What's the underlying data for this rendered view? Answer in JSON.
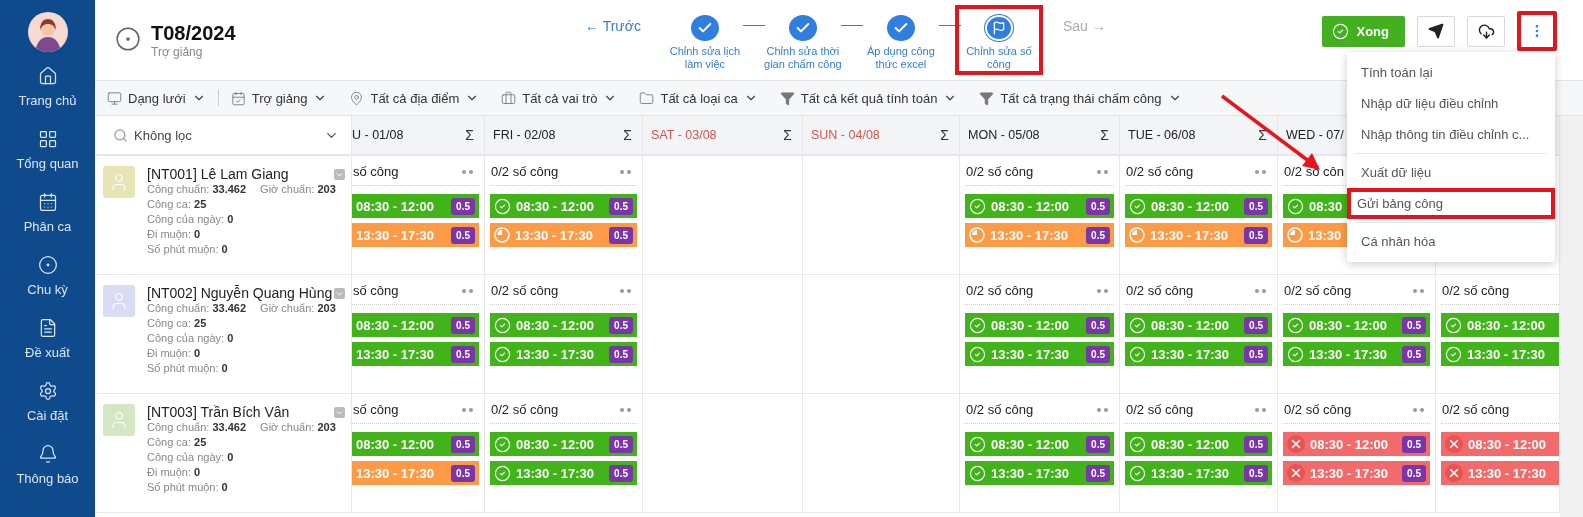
{
  "sidebar": {
    "items": [
      {
        "label": "Trang chủ"
      },
      {
        "label": "Tổng quan"
      },
      {
        "label": "Phân ca"
      },
      {
        "label": "Chu kỳ"
      },
      {
        "label": "Đề xuất"
      },
      {
        "label": "Cài đặt"
      },
      {
        "label": "Thông báo"
      }
    ]
  },
  "header": {
    "title": "T08/2024",
    "subtitle": "Trợ giảng",
    "prev": "← Trước",
    "next": "Sau →",
    "steps": [
      {
        "label": "Chỉnh sửa lịch làm việc",
        "done": true,
        "highlighted": false
      },
      {
        "label": "Chỉnh sửa thời gian chấm công",
        "done": true,
        "highlighted": false
      },
      {
        "label": "Áp dụng công thức excel",
        "done": true,
        "highlighted": false
      },
      {
        "label": "Chỉnh sửa số công",
        "done": false,
        "highlighted": true
      }
    ],
    "done_button": "Xong",
    "more_highlighted": true
  },
  "filters": [
    {
      "label": "Dạng lưới"
    },
    {
      "label": "Trợ giảng"
    },
    {
      "label": "Tất cả địa điểm"
    },
    {
      "label": "Tất cả vai trò"
    },
    {
      "label": "Tất cả loại ca"
    },
    {
      "label": "Tất cả kết quả tính toán"
    },
    {
      "label": "Tất cả trạng thái chấm công"
    }
  ],
  "table": {
    "employee_filter": "Không lọc",
    "columns": [
      {
        "kind": "cut-left",
        "label": "U - 01/08",
        "sum": "Σ",
        "weekend": false
      },
      {
        "kind": "full",
        "label": "FRI - 02/08",
        "sum": "Σ",
        "weekend": false
      },
      {
        "kind": "full",
        "label": "SAT - 03/08",
        "sum": "Σ",
        "weekend": true
      },
      {
        "kind": "full",
        "label": "SUN - 04/08",
        "sum": "Σ",
        "weekend": true
      },
      {
        "kind": "full",
        "label": "MON - 05/08",
        "sum": "Σ",
        "weekend": false
      },
      {
        "kind": "full",
        "label": "TUE - 06/08",
        "sum": "Σ",
        "weekend": false
      },
      {
        "kind": "full",
        "label": "WED - 07/",
        "weekend": false
      },
      {
        "kind": "cut-right"
      }
    ],
    "rows": [
      {
        "name": "[NT001] Lê Lam Giang",
        "color": "#e6e5b3",
        "stats": [
          [
            "Công chuẩn: **33.462**",
            "Giờ chuẩn: **203**"
          ],
          [
            "Công ca: **25**"
          ],
          [
            "Công của ngày: **0**"
          ],
          [
            "Đi muộn: **0**"
          ],
          [
            "Số phút muộn: **0**"
          ]
        ],
        "cells": [
          {
            "title": "số công",
            "menu": true,
            "shifts": [
              {
                "time": "08:30 - 12:00",
                "kind": "checked",
                "value": "0.5"
              },
              {
                "time": "13:30 - 17:30",
                "kind": "waiting",
                "value": "0.5"
              }
            ]
          },
          {
            "title": "0/2 số công",
            "menu": true,
            "shifts": [
              {
                "time": "08:30 - 12:00",
                "kind": "checked",
                "value": "0.5"
              },
              {
                "time": "13:30 - 17:30",
                "kind": "waiting",
                "value": "0.5"
              }
            ]
          },
          null,
          null,
          {
            "title": "0/2 số công",
            "menu": true,
            "shifts": [
              {
                "time": "08:30 - 12:00",
                "kind": "checked",
                "value": "0.5"
              },
              {
                "time": "13:30 - 17:30",
                "kind": "waiting",
                "value": "0.5"
              }
            ]
          },
          {
            "title": "0/2 số công",
            "menu": true,
            "shifts": [
              {
                "time": "08:30 - 12:00",
                "kind": "checked",
                "value": "0.5"
              },
              {
                "time": "13:30 - 17:30",
                "kind": "waiting",
                "value": "0.5"
              }
            ]
          },
          {
            "title": "0/2 số côn",
            "menu": false,
            "shifts": [
              {
                "time": "08:30",
                "kind": "checked"
              },
              {
                "time": "13:30",
                "kind": "waiting"
              }
            ]
          },
          null
        ]
      },
      {
        "name": "[NT002] Nguyễn Quang Hùng",
        "color": "#d9dcf3",
        "stats": [
          [
            "Công chuẩn: **33.462**",
            "Giờ chuẩn: **203**"
          ],
          [
            "Công ca: **25**"
          ],
          [
            "Công của ngày: **0**"
          ],
          [
            "Đi muộn: **0**"
          ],
          [
            "Số phút muộn: **0**"
          ]
        ],
        "cells": [
          {
            "title": "số công",
            "menu": true,
            "shifts": [
              {
                "time": "08:30 - 12:00",
                "kind": "checked",
                "value": "0.5"
              },
              {
                "time": "13:30 - 17:30",
                "kind": "checked",
                "value": "0.5"
              }
            ]
          },
          {
            "title": "0/2 số công",
            "menu": true,
            "shifts": [
              {
                "time": "08:30 - 12:00",
                "kind": "checked",
                "value": "0.5"
              },
              {
                "time": "13:30 - 17:30",
                "kind": "checked",
                "value": "0.5"
              }
            ]
          },
          null,
          null,
          {
            "title": "0/2 số công",
            "menu": true,
            "shifts": [
              {
                "time": "08:30 - 12:00",
                "kind": "checked",
                "value": "0.5"
              },
              {
                "time": "13:30 - 17:30",
                "kind": "checked",
                "value": "0.5"
              }
            ]
          },
          {
            "title": "0/2 số công",
            "menu": true,
            "shifts": [
              {
                "time": "08:30 - 12:00",
                "kind": "checked",
                "value": "0.5"
              },
              {
                "time": "13:30 - 17:30",
                "kind": "checked",
                "value": "0.5"
              }
            ]
          },
          {
            "title": "0/2 số công",
            "menu": true,
            "shifts": [
              {
                "time": "08:30 - 12:00",
                "kind": "checked",
                "value": "0.5"
              },
              {
                "time": "13:30 - 17:30",
                "kind": "checked",
                "value": "0.5"
              }
            ]
          },
          {
            "title": "0/2 số công",
            "menu": false,
            "shifts": [
              {
                "time": "08:30 - 12:00",
                "kind": "checked"
              },
              {
                "time": "13:30 - 17:30",
                "kind": "checked"
              }
            ]
          }
        ]
      },
      {
        "name": "[NT003] Trần Bích Vân",
        "color": "#d3e8c2",
        "stats": [
          [
            "Công chuẩn: **33.462**",
            "Giờ chuẩn: **203**"
          ],
          [
            "Công ca: **25**"
          ],
          [
            "Công của ngày: **0**"
          ],
          [
            "Đi muộn: **0**"
          ],
          [
            "Số phút muộn: **0**"
          ]
        ],
        "cells": [
          {
            "title": "số công",
            "menu": true,
            "shifts": [
              {
                "time": "08:30 - 12:00",
                "kind": "checked",
                "value": "0.5"
              },
              {
                "time": "13:30 - 17:30",
                "kind": "waiting",
                "value": "0.5"
              }
            ]
          },
          {
            "title": "0/2 số công",
            "menu": true,
            "shifts": [
              {
                "time": "08:30 - 12:00",
                "kind": "checked",
                "value": "0.5"
              },
              {
                "time": "13:30 - 17:30",
                "kind": "checked",
                "value": "0.5"
              }
            ]
          },
          null,
          null,
          {
            "title": "0/2 số công",
            "menu": true,
            "shifts": [
              {
                "time": "08:30 - 12:00",
                "kind": "checked",
                "value": "0.5"
              },
              {
                "time": "13:30 - 17:30",
                "kind": "checked",
                "value": "0.5"
              }
            ]
          },
          {
            "title": "0/2 số công",
            "menu": true,
            "shifts": [
              {
                "time": "08:30 - 12:00",
                "kind": "checked",
                "value": "0.5"
              },
              {
                "time": "13:30 - 17:30",
                "kind": "checked",
                "value": "0.5"
              }
            ]
          },
          {
            "title": "0/2 số công",
            "menu": true,
            "shifts": [
              {
                "time": "08:30 - 12:00",
                "kind": "absent",
                "value": "0.5"
              },
              {
                "time": "13:30 - 17:30",
                "kind": "absent",
                "value": "0.5"
              }
            ]
          },
          {
            "title": "0/2 số công",
            "menu": false,
            "shifts": [
              {
                "time": "08:30 - 12:00",
                "kind": "absent"
              },
              {
                "time": "13:30 - 17:30",
                "kind": "absent"
              }
            ]
          }
        ]
      }
    ]
  },
  "menu": {
    "groups": [
      [
        {
          "label": "Tính toán lại",
          "highlighted": false
        },
        {
          "label": "Nhập dữ liệu điều chỉnh",
          "highlighted": false
        },
        {
          "label": "Nhập thông tin điều chỉnh c...",
          "highlighted": false
        }
      ],
      [
        {
          "label": "Xuất dữ liệu",
          "highlighted": false
        },
        {
          "label": "Gửi bảng công",
          "highlighted": true
        }
      ],
      [
        {
          "label": "Cá nhân hóa",
          "highlighted": false
        }
      ]
    ]
  }
}
